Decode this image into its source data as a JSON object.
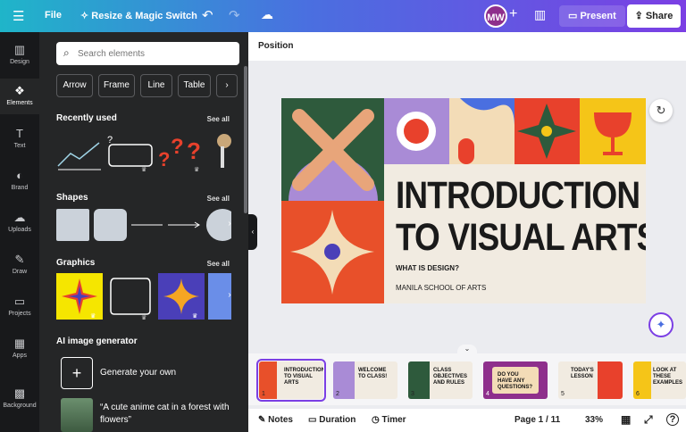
{
  "topbar": {
    "file": "File",
    "resize": "Resize & Magic Switch",
    "avatar": "MW",
    "present": "Present",
    "share": "Share"
  },
  "rail": [
    {
      "label": "Design",
      "icon": "design-icon",
      "glyph": "▥"
    },
    {
      "label": "Elements",
      "icon": "elements-icon",
      "glyph": "❖"
    },
    {
      "label": "Text",
      "icon": "text-icon",
      "glyph": "T"
    },
    {
      "label": "Brand",
      "icon": "brand-icon",
      "glyph": "◐"
    },
    {
      "label": "Uploads",
      "icon": "uploads-icon",
      "glyph": "☁"
    },
    {
      "label": "Draw",
      "icon": "draw-icon",
      "glyph": "✎"
    },
    {
      "label": "Projects",
      "icon": "projects-icon",
      "glyph": "▭"
    },
    {
      "label": "Apps",
      "icon": "apps-icon",
      "glyph": "▦"
    },
    {
      "label": "Background",
      "icon": "background-icon",
      "glyph": "▩"
    }
  ],
  "panel": {
    "search_placeholder": "Search elements",
    "chips": [
      "Arrow",
      "Frame",
      "Line",
      "Table"
    ],
    "recently_used": "Recently used",
    "see_all": "See all",
    "shapes": "Shapes",
    "graphics": "Graphics",
    "ai_generator": "AI image generator",
    "generate": "Generate your own",
    "prompt": "“A cute anime cat in a forest with flowers”"
  },
  "canvas": {
    "position": "Position",
    "title_line1": "INTRODUCTION",
    "title_line2": "TO VISUAL ARTS",
    "subtitle": "WHAT IS DESIGN?",
    "school": "MANILA SCHOOL OF ARTS"
  },
  "pages": [
    {
      "num": "1",
      "title": "INTRODUCTION TO VISUAL ARTS"
    },
    {
      "num": "2",
      "title": "WELCOME TO CLASS!"
    },
    {
      "num": "3",
      "title": "CLASS OBJECTIVES AND RULES"
    },
    {
      "num": "4",
      "title": "DO YOU HAVE ANY QUESTIONS?"
    },
    {
      "num": "5",
      "title": "TODAY'S LESSON"
    },
    {
      "num": "6",
      "title": "LOOK AT THESE EXAMPLES"
    }
  ],
  "bottombar": {
    "notes": "Notes",
    "duration": "Duration",
    "timer": "Timer",
    "page": "Page 1 / 11",
    "zoom": "33%"
  },
  "colors": {
    "accent": "#7b3fe4",
    "green": "#2e5a3c",
    "red": "#e8412c",
    "orange": "#e8502a",
    "yellow": "#f5c518",
    "purple": "#a98bd6",
    "cream": "#f1ebe1",
    "blue": "#4a6fe0"
  }
}
